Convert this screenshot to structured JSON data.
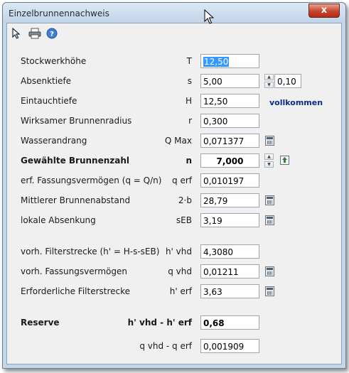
{
  "window": {
    "title": "Einzelbrunnennachweis",
    "close_label": "x"
  },
  "rows": {
    "stockwerkhoehe": {
      "label": "Stockwerkhöhe",
      "symbol": "T",
      "value": "12,50"
    },
    "absenktiefe": {
      "label": "Absenktiefe",
      "symbol": "s",
      "value": "5,00",
      "step": "0,10"
    },
    "eintauchtiefe": {
      "label": "Eintauchtiefe",
      "symbol": "H",
      "value": "12,50",
      "note": "vollkommen"
    },
    "brunnenradius": {
      "label": "Wirksamer Brunnenradius",
      "symbol": "r",
      "value": "0,300"
    },
    "wasserandrang": {
      "label": "Wasserandrang",
      "symbol": "Q Max",
      "value": "0,071377"
    },
    "brunnenzahl": {
      "label": "Gewählte Brunnenzahl",
      "symbol": "n",
      "value": "7,000"
    },
    "fassungsvermoegen": {
      "label": "erf. Fassungsvermögen (q = Q/n)",
      "symbol": "q erf",
      "value": "0,010197"
    },
    "brunnenabstand": {
      "label": "Mittlerer Brunnenabstand",
      "symbol": "2·b",
      "value": "28,79"
    },
    "lokale_absenkung": {
      "label": "lokale Absenkung",
      "symbol": "sEB",
      "value": "3,19"
    },
    "filterstrecke_vorh": {
      "label": "vorh. Filterstrecke (h' = H-s-sEB)",
      "symbol": "h' vhd",
      "value": "4,3080"
    },
    "fassungsvermoegen_vorh": {
      "label": "vorh. Fassungsvermögen",
      "symbol": "q vhd",
      "value": "0,01211"
    },
    "filterstrecke_erf": {
      "label": "Erforderliche Filterstrecke",
      "symbol": "h' erf",
      "value": "3,63"
    },
    "reserve": {
      "label": "Reserve",
      "symbol": "h' vhd - h' erf",
      "value": "0,68"
    },
    "reserve_q": {
      "symbol": "q vhd - q erf",
      "value": "0,001909"
    }
  },
  "icons": [
    "pointer-icon",
    "printer-icon",
    "help-icon",
    "calculator-icon",
    "export-icon"
  ]
}
